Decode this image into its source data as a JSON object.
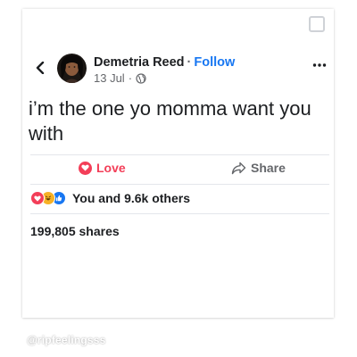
{
  "post": {
    "author": "Demetria Reed",
    "separator": "·",
    "follow_label": "Follow",
    "date": "13 Jul",
    "meta_separator": "·",
    "privacy_icon": "globe-icon",
    "text": "i’m the one yo momma want you with"
  },
  "actions": {
    "love_label": "Love",
    "share_label": "Share"
  },
  "stats": {
    "reactions_text": "You and 9.6k others",
    "shares_text": "199,805 shares"
  },
  "watermark": "@ripfeelingsss",
  "colors": {
    "love": "#f33e58",
    "follow": "#1877f2",
    "haha": "#f7b125",
    "like": "#1877f2",
    "text": "#1c1e21",
    "muted": "#65676b"
  },
  "icons": [
    "back-chevron-icon",
    "more-options-icon",
    "globe-icon",
    "heart-icon",
    "share-arrow-icon",
    "love-reaction-icon",
    "haha-reaction-icon",
    "like-reaction-icon",
    "square-checkbox-icon"
  ]
}
